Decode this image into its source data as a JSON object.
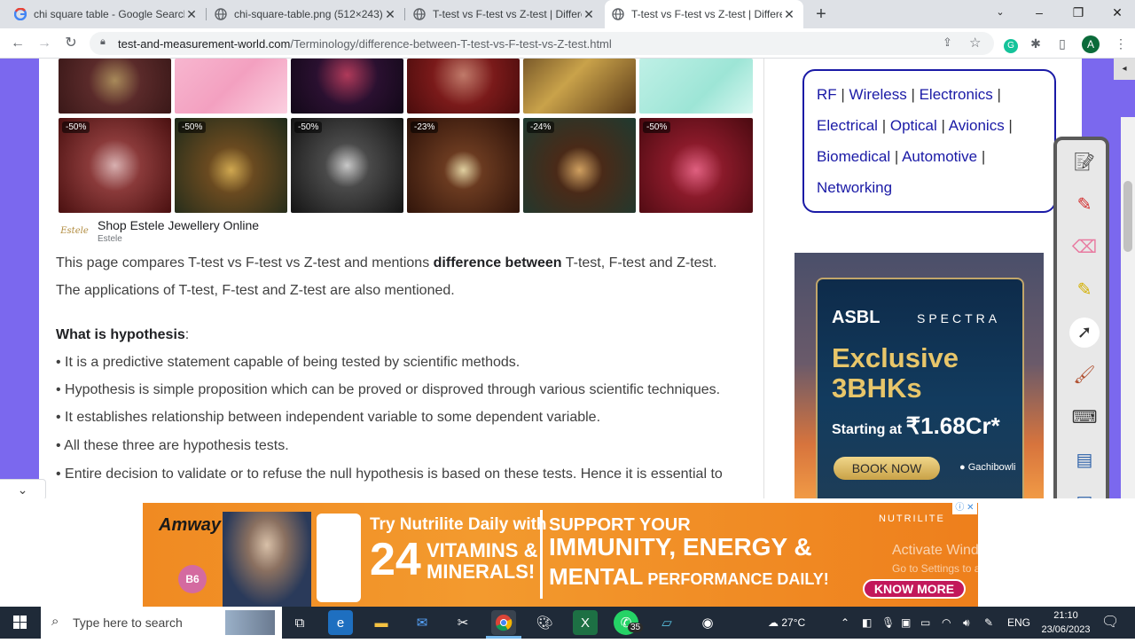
{
  "browser": {
    "tabs": [
      {
        "title": "chi square table - Google Search",
        "favicon": "google-icon",
        "active": false
      },
      {
        "title": "chi-square-table.png (512×243)",
        "favicon": "globe-icon",
        "active": false
      },
      {
        "title": "T-test vs F-test vs Z-test | Differe",
        "favicon": "globe-icon",
        "active": false
      },
      {
        "title": "T-test vs F-test vs Z-test | Differe",
        "favicon": "globe-icon",
        "active": true
      }
    ],
    "url_domain": "test-and-measurement-world.com",
    "url_path": "/Terminology/difference-between-T-test-vs-F-test-vs-Z-test.html",
    "profile_initial": "A",
    "extension_letter": "G"
  },
  "shop": {
    "logo_text": "Estele",
    "name": "Shop Estele Jewellery Online",
    "sub": "Estele",
    "discounts": [
      "-50%",
      "-50%",
      "-50%",
      "-23%",
      "-24%",
      "-50%"
    ]
  },
  "article": {
    "intro_1a": "This page compares T-test vs F-test vs Z-test and mentions ",
    "intro_1b": "difference between",
    "intro_1c": " T-test, F-test and Z-test.",
    "intro_2": "The applications of T-test, F-test and Z-test are also mentioned.",
    "heading": "What is hypothesis",
    "heading_colon": ":",
    "bullets": [
      "• It is a predictive statement capable of being tested by scientific methods.",
      "• Hypothesis is simple proposition which can be proved or disproved through various scientific techniques.",
      "• It establishes relationship between independent variable to some dependent variable.",
      "• All these three are hypothesis tests.",
      "• Entire decision to validate or to refuse the null hypothesis is based on these tests. Hence it is essential to"
    ]
  },
  "sidebar_links": {
    "row1": [
      "RF",
      "Wireless",
      "Electronics"
    ],
    "row2": [
      "Electrical",
      "Optical",
      "Avionics"
    ],
    "row3": [
      "Biomedical",
      "Automotive"
    ],
    "row4": [
      "Networking"
    ]
  },
  "ad_right": {
    "brand": "ASBL",
    "project": "SPECTRA",
    "headline_1": "Exclusive",
    "headline_2": "3BHKs",
    "price_prefix": "Starting at ",
    "price": "₹1.68Cr*",
    "cta": "BOOK NOW",
    "location": "Gachibowli"
  },
  "ad_bottom": {
    "brand": "Amway",
    "line_1": "Try Nutrilite Daily with",
    "number": "24",
    "line_2a": "VITAMINS &",
    "line_2b": "MINERALS!",
    "support_1": "SUPPORT YOUR",
    "support_2": "IMMUNITY, ENERGY &",
    "support_3a": "MENTAL",
    "support_3b": " PERFORMANCE DAILY!",
    "nutrilite": "NUTRILITE",
    "cta": "KNOW MORE",
    "b6": "B6"
  },
  "watermark": {
    "line_1": "Activate Windows",
    "line_2": "Go to Settings to activate Windows."
  },
  "taskbar": {
    "search_placeholder": "Type here to search",
    "weather": "27°C",
    "language": "ENG",
    "time": "21:10",
    "date": "23/06/2023",
    "whatsapp_badge": "35"
  }
}
